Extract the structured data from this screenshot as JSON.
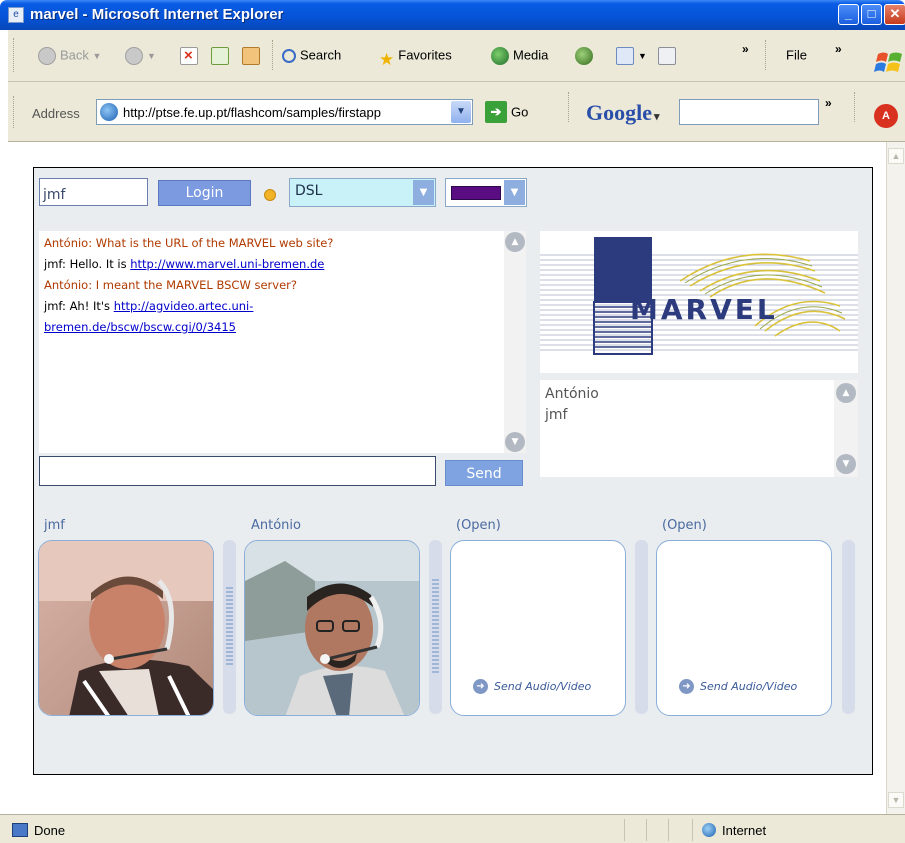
{
  "window": {
    "title": "marvel - Microsoft Internet Explorer",
    "min_glyph": "_",
    "max_glyph": "□",
    "close_glyph": "✕"
  },
  "toolbar": {
    "back_label": "Back",
    "search_label": "Search",
    "favorites_label": "Favorites",
    "media_label": "Media",
    "file_label": "File",
    "more_glyph": "»"
  },
  "address": {
    "label": "Address",
    "url": "http://ptse.fe.up.pt/flashcom/samples/firstapp",
    "go_label": "Go",
    "google_label": "Google"
  },
  "statusbar": {
    "status": "Done",
    "zone": "Internet"
  },
  "app": {
    "username": "jmf",
    "login_label": "Login",
    "bandwidth": "DSL",
    "selected_color": "#5a0d82",
    "status_color": "#f3b329",
    "speaker_color": "#b03a00",
    "chat": [
      {
        "text": "António: What is the URL of the MARVEL web site?",
        "link": ""
      },
      {
        "text": "jmf: Hello. It is ",
        "link": "http://www.marvel.uni-bremen.de"
      },
      {
        "text": "António: I meant the MARVEL BSCW server?",
        "link": ""
      },
      {
        "text": "jmf: Ah! It's ",
        "link": "http://agvideo.artec.uni-"
      },
      {
        "text": "",
        "link": "bremen.de/bscw/bscw.cgi/0/3415"
      }
    ],
    "send_label": "Send",
    "logo_text": "MARVEL",
    "users": [
      "António",
      "jmf"
    ],
    "av_slots": [
      {
        "label": "jmf",
        "level": 0.5
      },
      {
        "label": "António",
        "level": 0.6
      },
      {
        "label": "(Open)",
        "action": "Send Audio/Video"
      },
      {
        "label": "(Open)",
        "action": "Send Audio/Video"
      }
    ]
  }
}
